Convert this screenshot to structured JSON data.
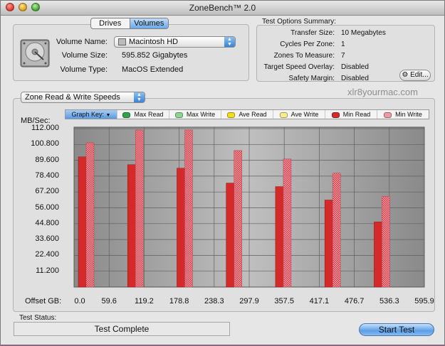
{
  "window": {
    "title": "ZoneBench™ 2.0"
  },
  "tabs": {
    "drives": "Drives",
    "volumes": "Volumes"
  },
  "volume": {
    "name_label": "Volume Name:",
    "name_value": "Macintosh HD",
    "size_label": "Volume Size:",
    "size_value": "595.852 Gigabytes",
    "type_label": "Volume Type:",
    "type_value": "MacOS Extended"
  },
  "summary": {
    "heading": "Test Options Summary:",
    "rows": [
      {
        "label": "Transfer Size:",
        "value": "10 Megabytes"
      },
      {
        "label": "Cycles Per Zone:",
        "value": "1"
      },
      {
        "label": "Zones To Measure:",
        "value": "7"
      },
      {
        "label": "Target Speed Overlay:",
        "value": "Disabled"
      },
      {
        "label": "Safety Margin:",
        "value": "Disabled"
      }
    ],
    "edit_label": "Edit..."
  },
  "watermark": "xlr8yourmac.com",
  "chart_selector": "Zone Read & Write Speeds",
  "legend": {
    "key_label": "Graph Key:",
    "items": [
      {
        "label": "Max Read",
        "color": "#2fa24a"
      },
      {
        "label": "Max Write",
        "color": "#8fd493"
      },
      {
        "label": "Ave Read",
        "color": "#f2df1c"
      },
      {
        "label": "Ave Write",
        "color": "#f7ee8f"
      },
      {
        "label": "Min Read",
        "color": "#d42a2a"
      },
      {
        "label": "Min Write",
        "color": "#ee9aa3"
      }
    ]
  },
  "axis": {
    "y_unit": "MB/Sec:",
    "x_label": "Offset GB:"
  },
  "chart_data": {
    "type": "bar",
    "ylabel": "MB/Sec:",
    "xlabel": "Offset GB:",
    "ylim": [
      0,
      112
    ],
    "yticks": [
      "112.000",
      "100.800",
      "89.600",
      "78.400",
      "67.200",
      "56.000",
      "44.800",
      "33.600",
      "22.400",
      "11.200"
    ],
    "x_ticks": [
      "0.0",
      "59.6",
      "119.2",
      "178.8",
      "238.3",
      "297.9",
      "357.5",
      "417.1",
      "476.7",
      "536.3",
      "595.9"
    ],
    "zones": [
      "0.0",
      "119.2",
      "238.3",
      "357.5",
      "476.7",
      "536.3",
      "595.9"
    ],
    "series": [
      {
        "name": "Min Read",
        "color": "#d42a2a",
        "values": [
          92,
          86.5,
          84,
          73.5,
          71,
          61.5,
          46
        ]
      },
      {
        "name": "Min Write",
        "color": "#ee9aa3",
        "values": [
          102,
          111,
          111,
          96.5,
          90.5,
          80.5,
          64
        ]
      }
    ]
  },
  "status": {
    "label": "Test Status:",
    "value": "Test Complete"
  },
  "start_button": "Start Test"
}
